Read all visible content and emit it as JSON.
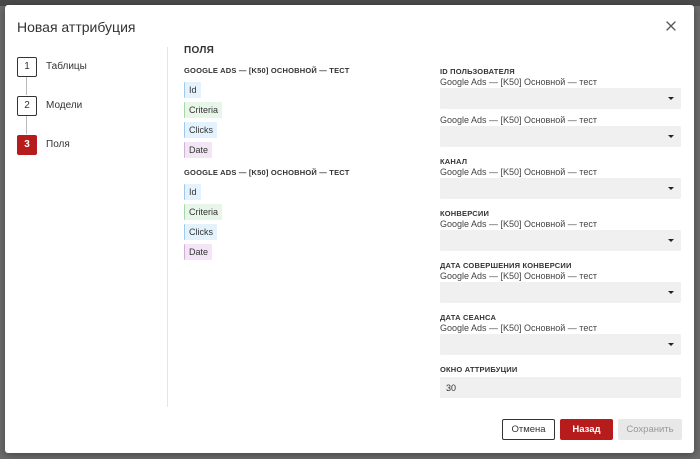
{
  "modal": {
    "title": "Новая аттрибуция"
  },
  "steps": [
    {
      "number": "1",
      "label": "Таблицы",
      "active": false
    },
    {
      "number": "2",
      "label": "Модели",
      "active": false
    },
    {
      "number": "3",
      "label": "Поля",
      "active": true
    }
  ],
  "fields_section": {
    "heading": "ПОЛЯ",
    "groups": [
      {
        "heading": "GOOGLE ADS — [K50] ОСНОВНОЙ — ТЕСТ",
        "tags": [
          "Id",
          "Criteria",
          "Clicks",
          "Date"
        ]
      },
      {
        "heading": "GOOGLE ADS — [K50] ОСНОВНОЙ — ТЕСТ",
        "tags": [
          "Id",
          "Criteria",
          "Clicks",
          "Date"
        ]
      }
    ]
  },
  "form": {
    "user_id": {
      "label": "ID ПОЛЬЗОВАТЕЛЯ",
      "source_1": "Google Ads — [K50] Основной — тест",
      "value_1": "",
      "source_2": "Google Ads — [K50] Основной — тест",
      "value_2": ""
    },
    "channel": {
      "label": "КАНАЛ",
      "source": "Google Ads — [K50] Основной — тест",
      "value": ""
    },
    "conversions": {
      "label": "КОНВЕРСИИ",
      "source": "Google Ads — [K50] Основной — тест",
      "value": ""
    },
    "conversion_date": {
      "label": "ДАТА СОВЕРШЕНИЯ КОНВЕРСИИ",
      "source": "Google Ads — [K50] Основной — тест",
      "value": ""
    },
    "session_date": {
      "label": "ДАТА СЕАНСА",
      "source": "Google Ads — [K50] Основной — тест",
      "value": ""
    },
    "attribution_window": {
      "label": "ОКНО АТТРИБУЦИИ",
      "value": "30"
    }
  },
  "footer": {
    "cancel_label": "Отмена",
    "back_label": "Назад",
    "save_label": "Сохранить"
  },
  "colors": {
    "accent": "#b71c1c",
    "tag_id": "#e3f2fd",
    "tag_criteria": "#e8f5e9",
    "tag_clicks": "#e3f2fd",
    "tag_date": "#f3e5f5"
  }
}
